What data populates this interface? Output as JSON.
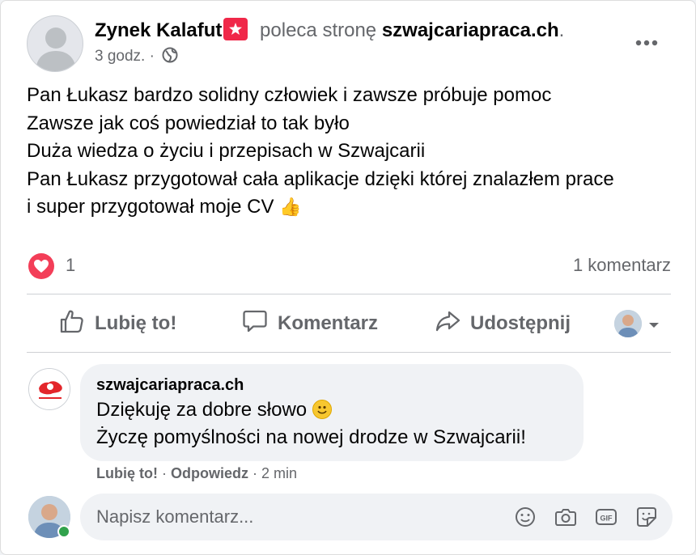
{
  "post": {
    "author": "Zynek Kalafut",
    "action_text": "poleca stronę",
    "page_name": "szwajcariapraca.ch",
    "period": ".",
    "time": "3 godz.",
    "dot": "·",
    "body_lines": [
      "Pan Łukasz bardzo solidny człowiek i zawsze  próbuje pomoc",
      "Zawsze jak coś powiedział to tak było",
      "Duża wiedza o życiu i przepisach w Szwajcarii",
      "Pan Łukasz przygotował cała aplikacje dzięki której znalazłem prace",
      "i super przygotował moje CV"
    ],
    "thumb_emoji": "👍"
  },
  "stats": {
    "reaction_count": "1",
    "comment_count": "1 komentarz"
  },
  "actions": {
    "like": "Lubię to!",
    "comment": "Komentarz",
    "share": "Udostępnij"
  },
  "comment": {
    "author": "szwajcariapraca.ch",
    "line1": "Dziękuję za dobre słowo",
    "line2": "Życzę pomyślności na nowej drodze w Szwajcarii!",
    "like": "Lubię to!",
    "sep": "·",
    "reply": "Odpowiedz",
    "time": "2 min"
  },
  "composer": {
    "placeholder": "Napisz komentarz..."
  },
  "icons": {
    "recommend": "recommend-star-icon",
    "audience": "globe-icon",
    "more": "more-dots-icon",
    "reaction": "heart-reaction-icon",
    "composer": [
      "emoji-icon",
      "camera-icon",
      "gif-icon",
      "sticker-icon"
    ]
  },
  "colors": {
    "heart": "#f33e58",
    "recommend": "#f02849",
    "secondary_text": "#65676b",
    "online": "#31a24c",
    "bubble": "#f0f2f5"
  }
}
